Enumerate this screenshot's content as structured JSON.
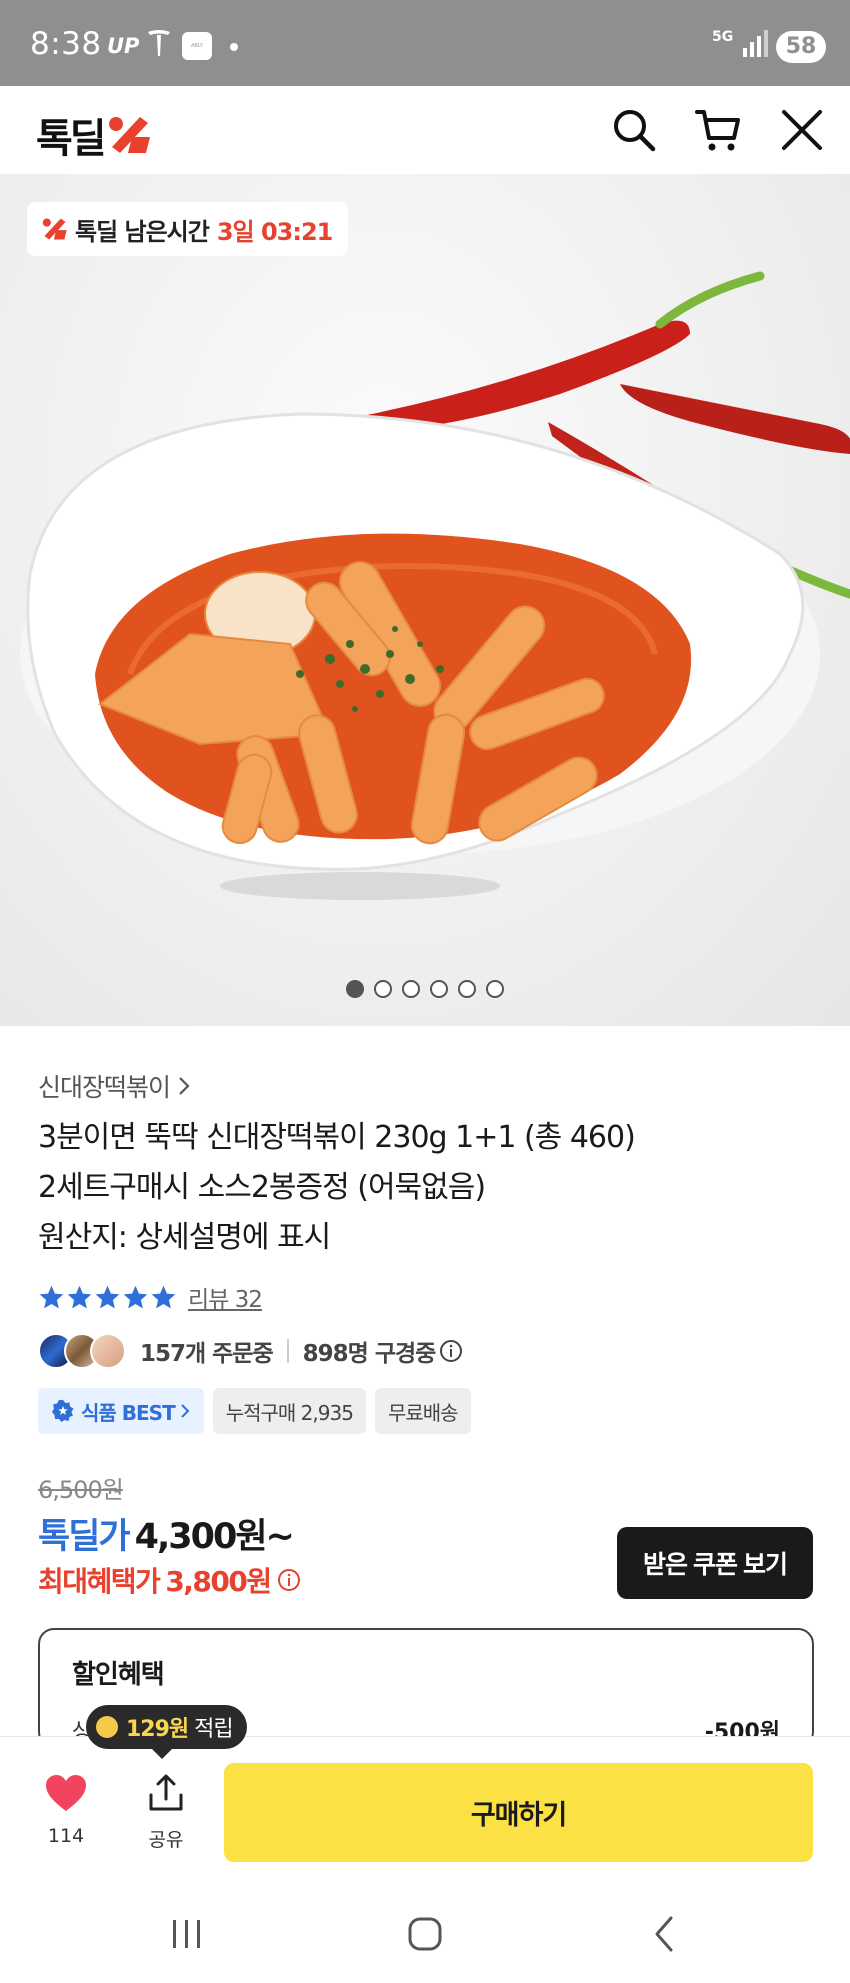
{
  "status_bar": {
    "time": "8:38",
    "carrier": "UP",
    "app_badge": "ABLY",
    "network": "5G",
    "battery": "58"
  },
  "header": {
    "logo_text": "톡딜",
    "icons": [
      "search-icon",
      "cart-icon",
      "close-icon"
    ]
  },
  "hero": {
    "timer_label": "톡딜 남은시간",
    "timer_value": "3일 03:21",
    "total_images": 6,
    "active_image": 1
  },
  "product": {
    "brand": "신대장떡볶이",
    "title_lines": [
      "3분이면 뚝딱 신대장떡볶이 230g 1+1 (총 460)",
      "2세트구매시 소스2봉증정 (어묵없음)",
      "원산지: 상세설명에 표시"
    ],
    "rating_stars": 5,
    "review_label": "리뷰 32",
    "orders_text": "157개 주문중",
    "viewers_text": "898명 구경중",
    "tags": {
      "best": "식품 BEST",
      "cumulative": "누적구매 2,935",
      "shipping": "무료배송"
    }
  },
  "price": {
    "original": "6,500원",
    "deal_label": "톡딜가",
    "deal_price": "4,300원~",
    "max_benefit_label": "최대혜택가",
    "max_benefit_price": "3,800원",
    "coupon_button": "받은 쿠폰 보기"
  },
  "benefit": {
    "title": "할인혜택",
    "row_label": "상",
    "row_value": "-500원"
  },
  "bottom_bar": {
    "like_count": "114",
    "share_label": "공유",
    "buy_label": "구매하기",
    "points_amount": "129원",
    "points_suffix": "적립"
  },
  "colors": {
    "accent_blue": "#2f6fd8",
    "accent_red": "#e8412e",
    "buy_yellow": "#fbe144",
    "heart_pink": "#f0445f"
  }
}
